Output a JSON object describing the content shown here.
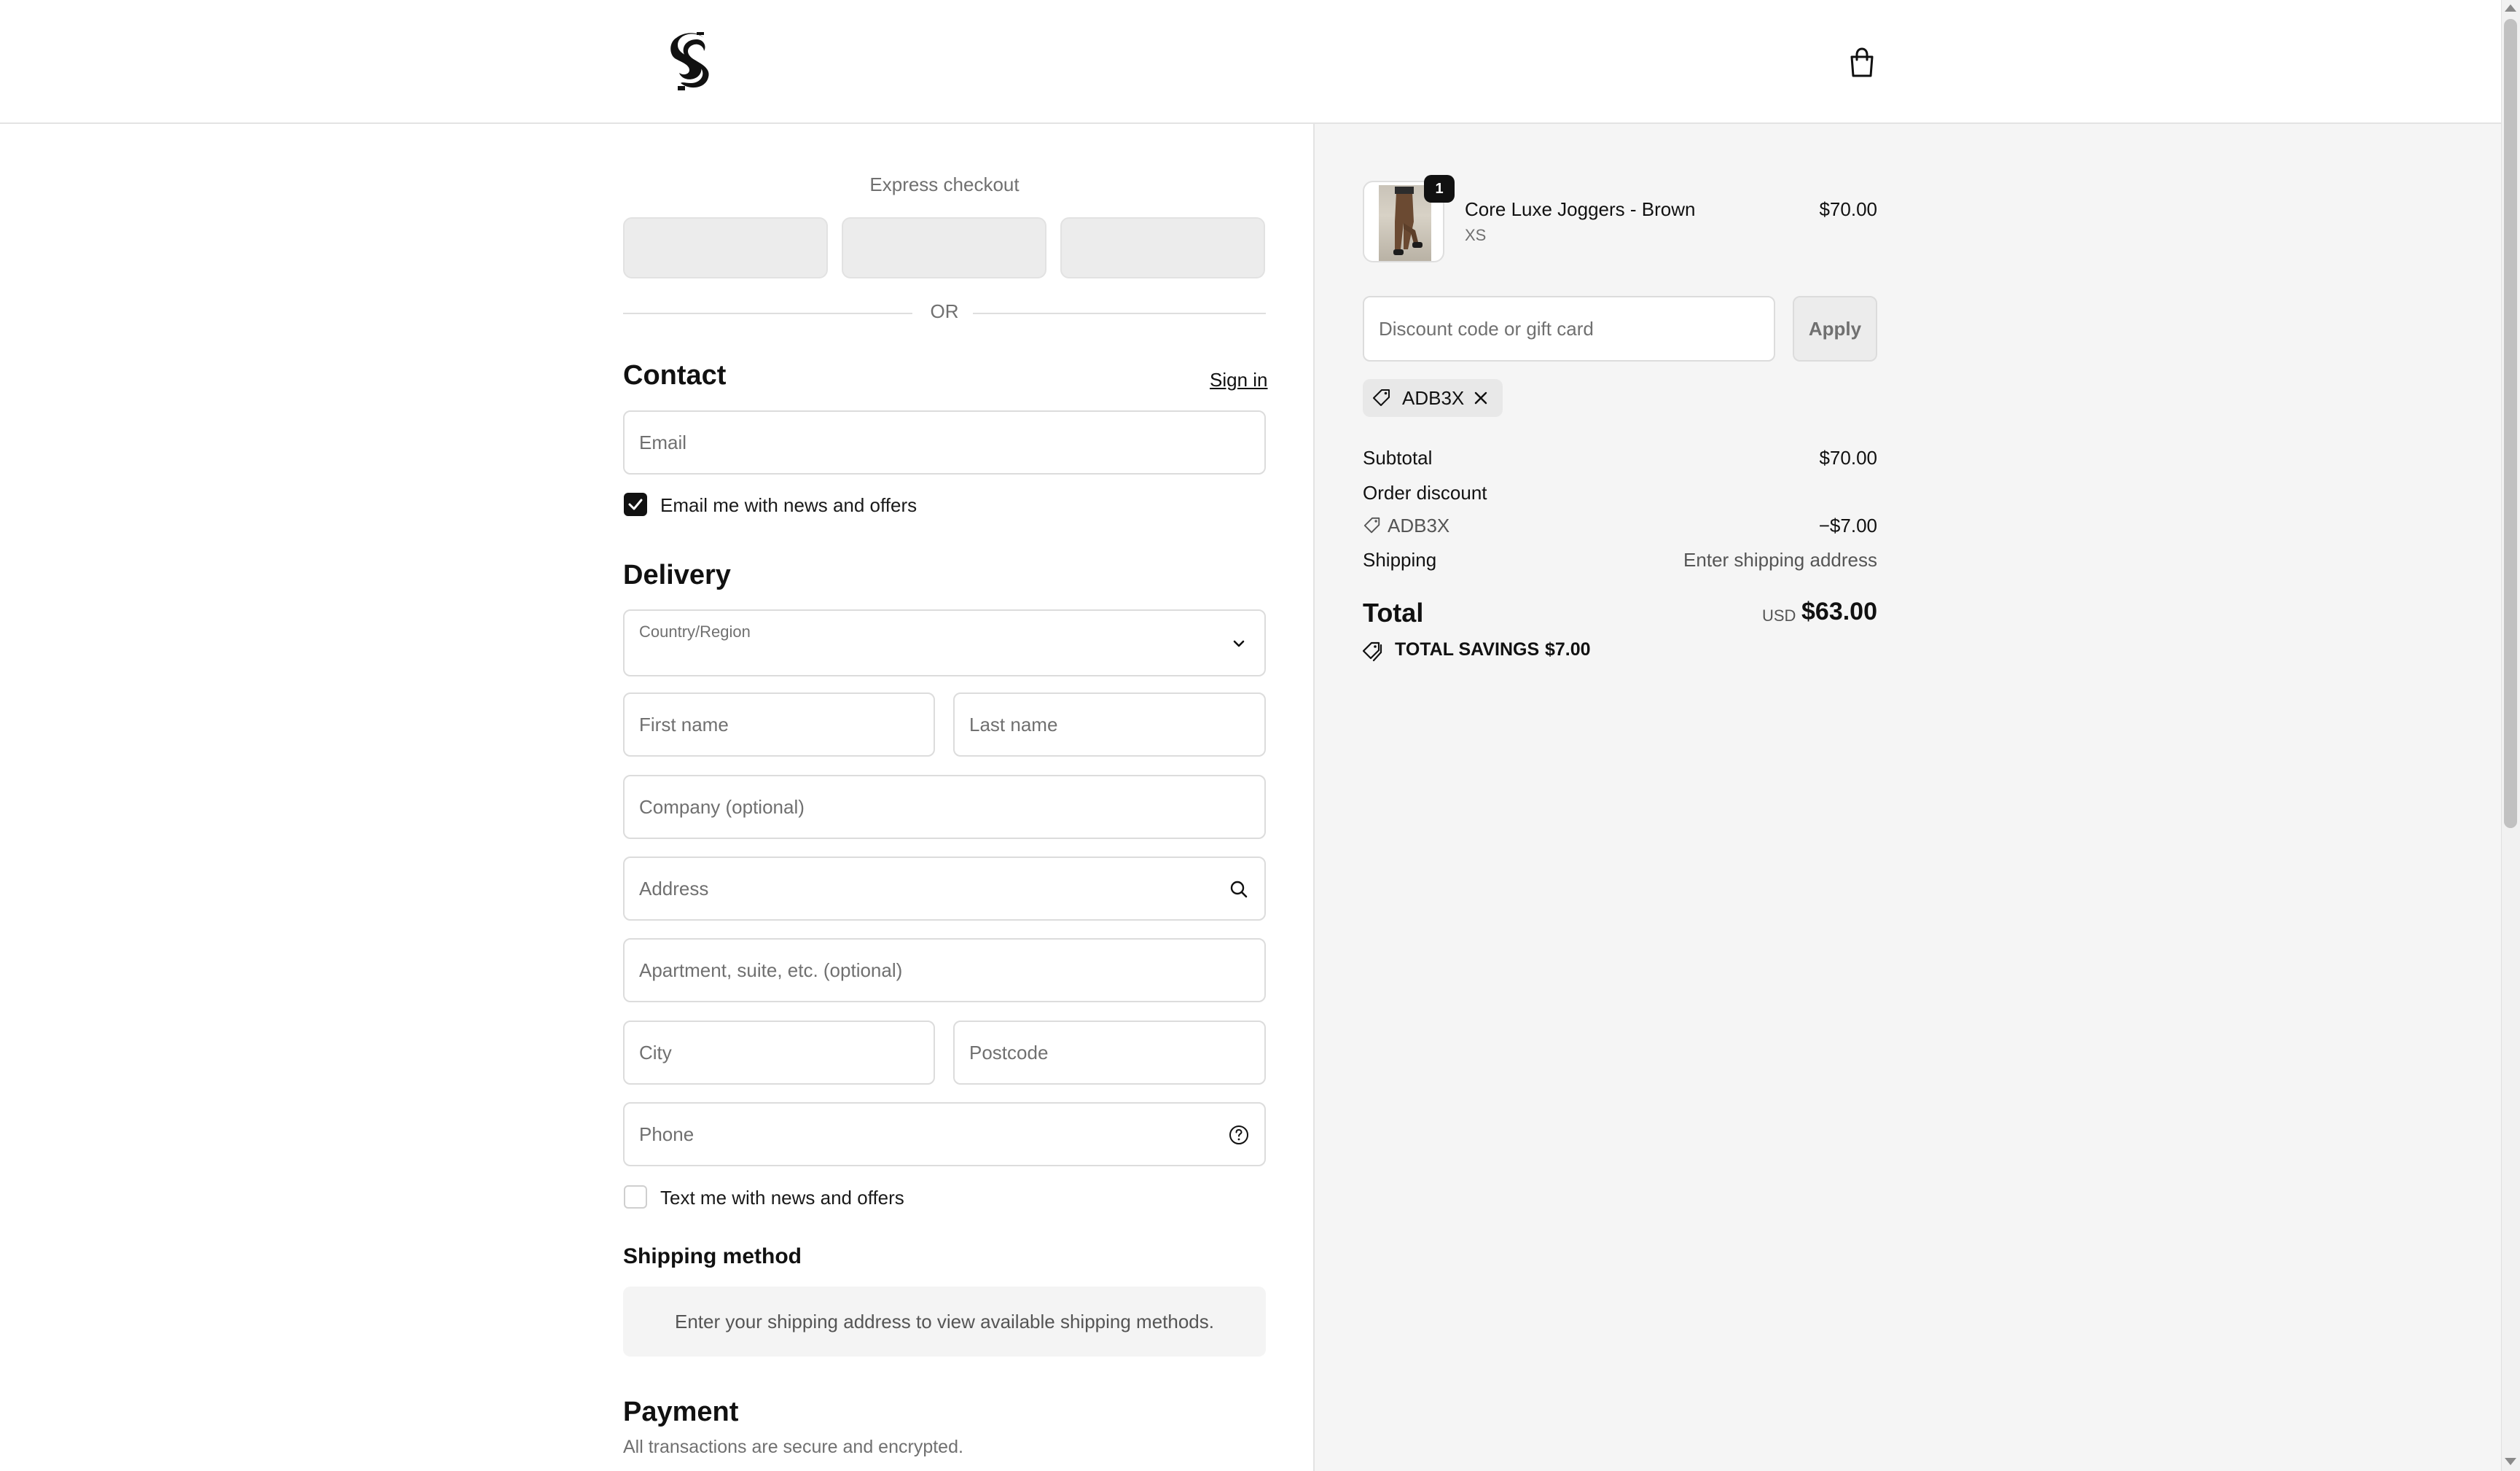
{
  "header": {
    "logo_icon": "gothic-s-logo",
    "cart_icon": "shopping-bag-icon"
  },
  "express": {
    "title": "Express checkout",
    "or_text": "OR"
  },
  "contact": {
    "title": "Contact",
    "sign_in": "Sign in",
    "email_placeholder": "Email",
    "news_checkbox_label": "Email me with news and offers",
    "news_checked": true
  },
  "delivery": {
    "title": "Delivery",
    "country_label": "Country/Region",
    "country_value": "",
    "first_name_placeholder": "First name",
    "last_name_placeholder": "Last name",
    "company_placeholder": "Company (optional)",
    "address_placeholder": "Address",
    "apartment_placeholder": "Apartment, suite, etc. (optional)",
    "city_placeholder": "City",
    "postcode_placeholder": "Postcode",
    "phone_placeholder": "Phone",
    "sms_checkbox_label": "Text me with news and offers",
    "sms_checked": false
  },
  "shipping_method": {
    "title": "Shipping method",
    "message": "Enter your shipping address to view available shipping methods."
  },
  "payment": {
    "title": "Payment",
    "subtitle": "All transactions are secure and encrypted."
  },
  "summary": {
    "product": {
      "quantity": "1",
      "name": "Core Luxe Joggers - Brown",
      "variant": "XS",
      "price": "$70.00"
    },
    "discount_placeholder": "Discount code or gift card",
    "apply_label": "Apply",
    "applied_code": "ADB3X",
    "subtotal_label": "Subtotal",
    "subtotal_value": "$70.00",
    "order_discount_label": "Order discount",
    "order_discount_code": "ADB3X",
    "order_discount_value": "−$7.00",
    "shipping_label": "Shipping",
    "shipping_value": "Enter shipping address",
    "total_label": "Total",
    "currency": "USD",
    "total_value": "$63.00",
    "savings_label": "TOTAL SAVINGS",
    "savings_value": "$7.00"
  },
  "colors": {
    "accent": "#111111",
    "summary_bg": "#f5f5f5",
    "border": "#dcdcdc",
    "muted_text": "#707070"
  }
}
